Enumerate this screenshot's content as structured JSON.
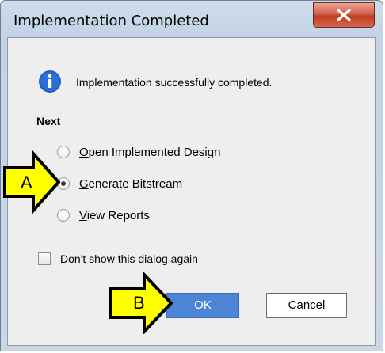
{
  "window": {
    "title": "Implementation Completed"
  },
  "message": {
    "icon": "info-icon",
    "text": "Implementation successfully completed."
  },
  "section": {
    "label": "Next"
  },
  "options": [
    {
      "mnemonic": "O",
      "rest": "pen Implemented Design",
      "selected": false
    },
    {
      "mnemonic": "G",
      "rest": "enerate Bitstream",
      "selected": true
    },
    {
      "mnemonic": "V",
      "rest": "iew Reports",
      "selected": false
    }
  ],
  "checkbox": {
    "mnemonic": "D",
    "rest": "on't show this dialog again",
    "checked": false
  },
  "buttons": {
    "ok": "OK",
    "cancel": "Cancel"
  },
  "callouts": {
    "a": "A",
    "b": "B"
  },
  "colors": {
    "ok_button": "#4c84d6",
    "callout_fill": "#ffff00",
    "close_button": "#c9452a"
  }
}
